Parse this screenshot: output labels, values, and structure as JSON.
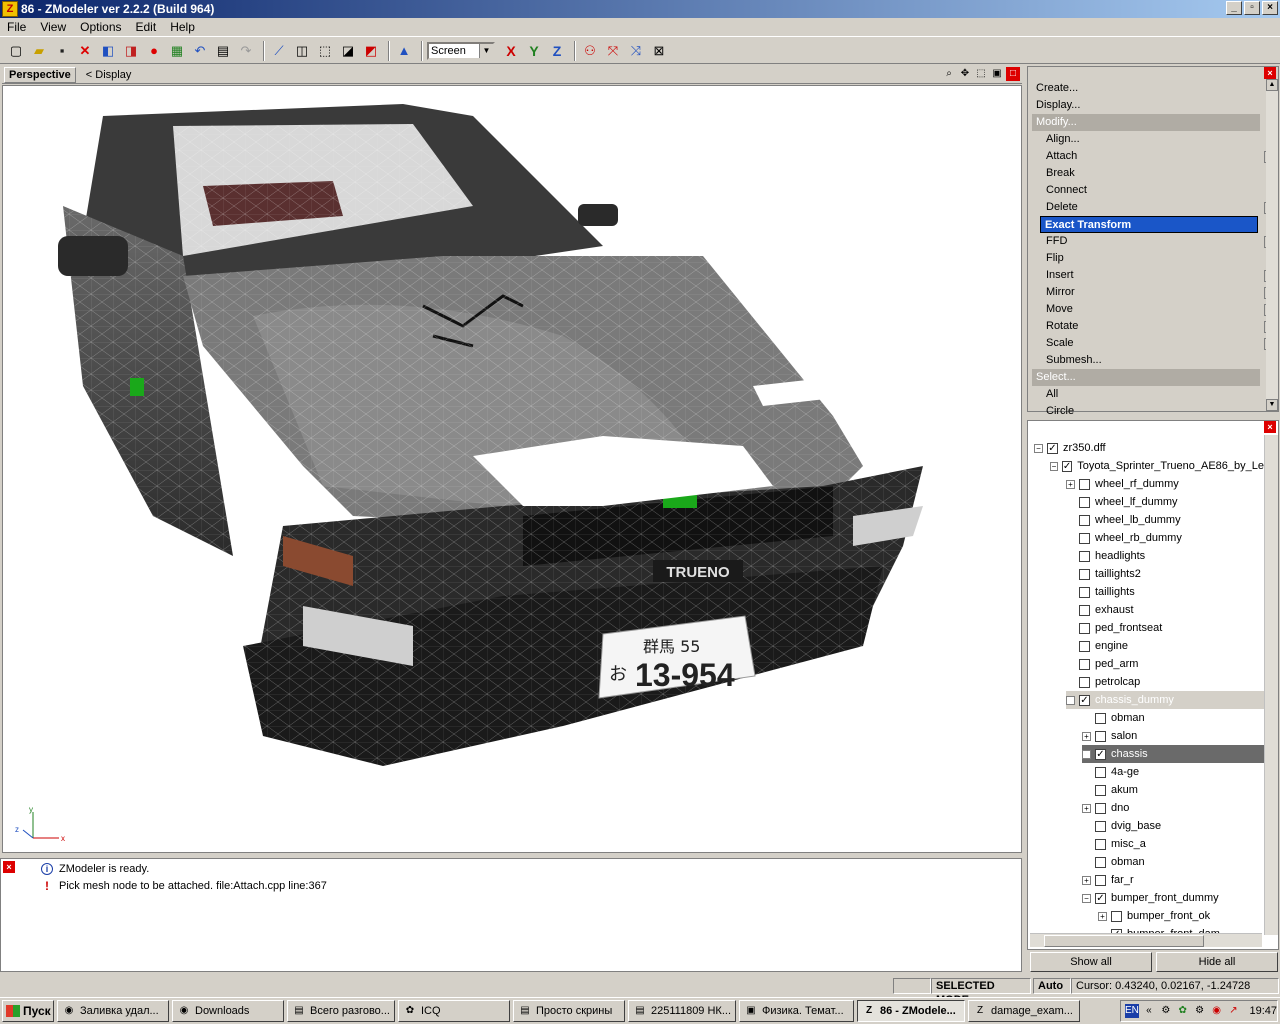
{
  "window": {
    "title": "86 - ZModeler ver 2.2.2 (Build 964)",
    "app_icon": "Z"
  },
  "menu": [
    "File",
    "View",
    "Options",
    "Edit",
    "Help"
  ],
  "toolbar": {
    "view_select": "Screen",
    "axes": [
      "X",
      "Y",
      "Z"
    ]
  },
  "viewport": {
    "tab": "Perspective",
    "display_label": "< Display",
    "axes": {
      "x": "x",
      "y": "y",
      "z": "z"
    },
    "plate_top": "群馬 55",
    "plate_kana": "お",
    "plate_number": "13-954",
    "brand": "TRUENO"
  },
  "log": [
    {
      "icon": "info-icon",
      "text": "ZModeler is ready."
    },
    {
      "icon": "warning-icon",
      "text": "Pick mesh node to be attached. file:Attach.cpp line:367"
    }
  ],
  "commands": [
    {
      "label": "Create...",
      "kind": "top"
    },
    {
      "label": "Display...",
      "kind": "top"
    },
    {
      "label": "Modify...",
      "kind": "group"
    },
    {
      "label": "Align...",
      "kind": "sub"
    },
    {
      "label": "Attach",
      "kind": "sub",
      "check": true
    },
    {
      "label": "Break",
      "kind": "sub"
    },
    {
      "label": "Connect",
      "kind": "sub"
    },
    {
      "label": "Delete",
      "kind": "sub",
      "check": true
    },
    {
      "label": "Exact Transform",
      "kind": "selected"
    },
    {
      "label": "FFD",
      "kind": "sub",
      "check": true
    },
    {
      "label": "Flip",
      "kind": "sub"
    },
    {
      "label": "Insert",
      "kind": "sub",
      "check": true
    },
    {
      "label": "Mirror",
      "kind": "sub",
      "check": true
    },
    {
      "label": "Move",
      "kind": "sub",
      "check": true
    },
    {
      "label": "Rotate",
      "kind": "sub",
      "check": true
    },
    {
      "label": "Scale",
      "kind": "sub",
      "check": true
    },
    {
      "label": "Submesh...",
      "kind": "sub"
    },
    {
      "label": "Select...",
      "kind": "group"
    },
    {
      "label": "All",
      "kind": "sub"
    },
    {
      "label": "Circle",
      "kind": "sub"
    }
  ],
  "tree": [
    {
      "label": "zr350.dff",
      "indent": 0,
      "exp": "-",
      "checked": true
    },
    {
      "label": "Toyota_Sprinter_Trueno_AE86_by_Le",
      "indent": 1,
      "exp": "-",
      "checked": true
    },
    {
      "label": "wheel_rf_dummy",
      "indent": 2,
      "exp": "+",
      "checked": false
    },
    {
      "label": "wheel_lf_dummy",
      "indent": 2,
      "exp": "",
      "checked": false
    },
    {
      "label": "wheel_lb_dummy",
      "indent": 2,
      "exp": "",
      "checked": false
    },
    {
      "label": "wheel_rb_dummy",
      "indent": 2,
      "exp": "",
      "checked": false
    },
    {
      "label": "headlights",
      "indent": 2,
      "exp": "",
      "checked": false
    },
    {
      "label": "taillights2",
      "indent": 2,
      "exp": "",
      "checked": false
    },
    {
      "label": "taillights",
      "indent": 2,
      "exp": "",
      "checked": false
    },
    {
      "label": "exhaust",
      "indent": 2,
      "exp": "",
      "checked": false
    },
    {
      "label": "ped_frontseat",
      "indent": 2,
      "exp": "",
      "checked": false
    },
    {
      "label": "engine",
      "indent": 2,
      "exp": "",
      "checked": false
    },
    {
      "label": "ped_arm",
      "indent": 2,
      "exp": "",
      "checked": false
    },
    {
      "label": "petrolcap",
      "indent": 2,
      "exp": "",
      "checked": false
    },
    {
      "label": "chassis_dummy",
      "indent": 2,
      "exp": "-",
      "checked": true,
      "style": "hl"
    },
    {
      "label": "obman",
      "indent": 3,
      "exp": "",
      "checked": false
    },
    {
      "label": "salon",
      "indent": 3,
      "exp": "+",
      "checked": false
    },
    {
      "label": "chassis",
      "indent": 3,
      "exp": "+",
      "checked": true,
      "style": "dark"
    },
    {
      "label": "4a-ge",
      "indent": 3,
      "exp": "",
      "checked": false
    },
    {
      "label": "akum",
      "indent": 3,
      "exp": "",
      "checked": false
    },
    {
      "label": "dno",
      "indent": 3,
      "exp": "+",
      "checked": false
    },
    {
      "label": "dvig_base",
      "indent": 3,
      "exp": "",
      "checked": false
    },
    {
      "label": "misc_a",
      "indent": 3,
      "exp": "",
      "checked": false
    },
    {
      "label": "obman",
      "indent": 3,
      "exp": "",
      "checked": false
    },
    {
      "label": "far_r",
      "indent": 3,
      "exp": "+",
      "checked": false
    },
    {
      "label": "bumper_front_dummy",
      "indent": 3,
      "exp": "-",
      "checked": true
    },
    {
      "label": "bumper_front_ok",
      "indent": 4,
      "exp": "+",
      "checked": false
    },
    {
      "label": "bumper_front_dam",
      "indent": 4,
      "exp": "",
      "checked": true
    }
  ],
  "buttons": {
    "show_all": "Show all",
    "hide_all": "Hide all"
  },
  "status": {
    "mode": "SELECTED MODE",
    "auto": "Auto",
    "cursor": "Cursor: 0.43240, 0.02167, -1.24728"
  },
  "taskbar": {
    "start": "Пуск",
    "tasks": [
      {
        "label": "Заливка удал...",
        "icon": "firefox-icon",
        "glyph": "◉",
        "width": 112,
        "active": false
      },
      {
        "label": "Downloads",
        "icon": "firefox-icon",
        "glyph": "◉",
        "width": 112,
        "active": false
      },
      {
        "label": "Всего разгово...",
        "icon": "folder-icon",
        "glyph": "▤",
        "width": 108,
        "active": false
      },
      {
        "label": "ICQ",
        "icon": "icq-icon",
        "glyph": "✿",
        "width": 112,
        "active": false
      },
      {
        "label": "Просто скрины",
        "icon": "folder-icon",
        "glyph": "▤",
        "width": 112,
        "active": false
      },
      {
        "label": "225111809 НК...",
        "icon": "folder-icon",
        "glyph": "▤",
        "width": 108,
        "active": false
      },
      {
        "label": "Физика. Темат...",
        "icon": "pdf-icon",
        "glyph": "▣",
        "width": 115,
        "active": false
      },
      {
        "label": "86 - ZModele...",
        "icon": "zmodeler-icon",
        "glyph": "Z",
        "width": 108,
        "active": true
      },
      {
        "label": "damage_exam...",
        "icon": "zmodeler-icon",
        "glyph": "Z",
        "width": 112,
        "active": false
      }
    ],
    "lang": "EN",
    "clock": "19:47"
  }
}
